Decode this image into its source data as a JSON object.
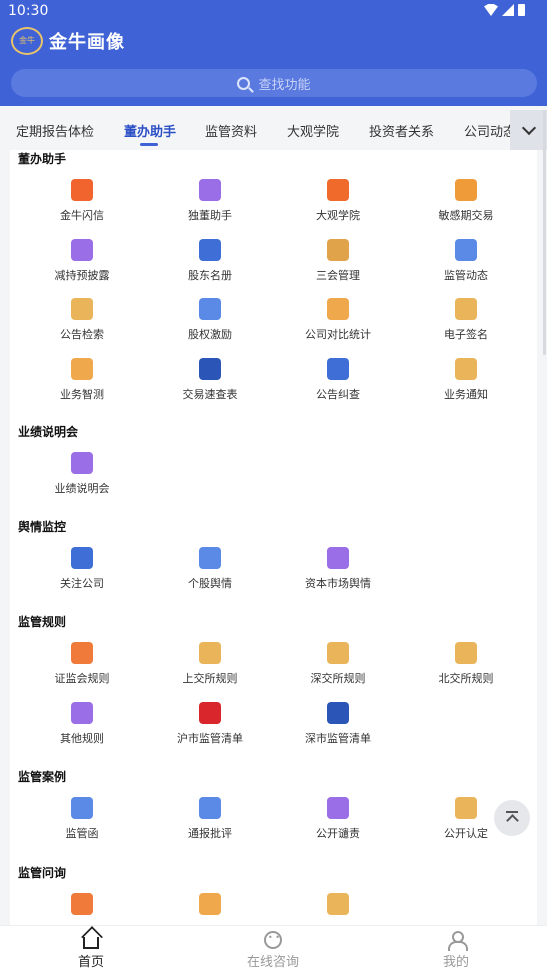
{
  "status_bar": {
    "time": "10:30"
  },
  "app": {
    "title": "金牛画像",
    "logo_text": "金牛"
  },
  "search": {
    "placeholder": "查找功能"
  },
  "tabs": [
    "定期报告体检",
    "董办助手",
    "监管资料",
    "大观学院",
    "投资者关系",
    "公司动态"
  ],
  "active_tab": "董办助手",
  "sections": [
    {
      "title": "董办助手",
      "items": [
        {
          "label": "金牛闪信",
          "icon": "lightning-icon",
          "color": "#f2642d"
        },
        {
          "label": "独董助手",
          "icon": "person-icon",
          "color": "#9a6ee6"
        },
        {
          "label": "大观学院",
          "icon": "graduation-cap-icon",
          "color": "#f06a2b"
        },
        {
          "label": "敏感期交易",
          "icon": "coin-hand-icon",
          "color": "#f09b3a"
        },
        {
          "label": "减持预披露",
          "icon": "document-list-icon",
          "color": "#9a6ee6"
        },
        {
          "label": "股东名册",
          "icon": "roster-icon",
          "color": "#3f6fd6"
        },
        {
          "label": "三会管理",
          "icon": "meeting-icon",
          "color": "#e0a34a"
        },
        {
          "label": "监管动态",
          "icon": "news-icon",
          "color": "#5b8ae6"
        },
        {
          "label": "公告检索",
          "icon": "briefcase-icon",
          "color": "#e9b45a"
        },
        {
          "label": "股权激励",
          "icon": "pie-chart-icon",
          "color": "#5b8ae6"
        },
        {
          "label": "公司对比统计",
          "icon": "compare-icon",
          "color": "#f0a84c"
        },
        {
          "label": "电子签名",
          "icon": "pen-icon",
          "color": "#e9b45a"
        },
        {
          "label": "业务智测",
          "icon": "checklist-icon",
          "color": "#f0a84c"
        },
        {
          "label": "交易速查表",
          "icon": "search-table-icon",
          "color": "#2c55b8"
        },
        {
          "label": "公告纠查",
          "icon": "house-search-icon",
          "color": "#3f6fd6"
        },
        {
          "label": "业务通知",
          "icon": "notice-icon",
          "color": "#e9b45a"
        }
      ]
    },
    {
      "title": "业绩说明会",
      "items": [
        {
          "label": "业绩说明会",
          "icon": "presentation-icon",
          "color": "#9a6ee6"
        }
      ]
    },
    {
      "title": "舆情监控",
      "items": [
        {
          "label": "关注公司",
          "icon": "building-icon",
          "color": "#3f6fd6"
        },
        {
          "label": "个股舆情",
          "icon": "stock-bars-icon",
          "color": "#5b8ae6"
        },
        {
          "label": "资本市场舆情",
          "icon": "market-chart-icon",
          "color": "#9a6ee6"
        }
      ]
    },
    {
      "title": "监管规则",
      "items": [
        {
          "label": "证监会规则",
          "icon": "rule-doc-icon",
          "color": "#f07a3a"
        },
        {
          "label": "上交所规则",
          "icon": "rule-doc-icon",
          "color": "#e9b45a"
        },
        {
          "label": "深交所规则",
          "icon": "rule-doc-icon",
          "color": "#e9b45a"
        },
        {
          "label": "北交所规则",
          "icon": "rule-doc-icon",
          "color": "#e9b45a"
        },
        {
          "label": "其他规则",
          "icon": "rule-doc-icon",
          "color": "#9a6ee6"
        },
        {
          "label": "沪市监管清单",
          "icon": "list-doc-icon",
          "color": "#d9262c"
        },
        {
          "label": "深市监管清单",
          "icon": "list-doc-icon",
          "color": "#2c55b8"
        }
      ]
    },
    {
      "title": "监管案例",
      "items": [
        {
          "label": "监管函",
          "icon": "envelope-icon",
          "color": "#5b8ae6"
        },
        {
          "label": "通报批评",
          "icon": "warning-icon",
          "color": "#5b8ae6"
        },
        {
          "label": "公开谴责",
          "icon": "alarm-icon",
          "color": "#9a6ee6"
        },
        {
          "label": "公开认定",
          "icon": "badge-alert-icon",
          "color": "#e9b45a"
        }
      ]
    },
    {
      "title": "监管问询",
      "items": [
        {
          "label": "",
          "icon": "question-chat-icon",
          "color": "#f07a3a"
        },
        {
          "label": "",
          "icon": "question-chat-icon",
          "color": "#f0a84c"
        },
        {
          "label": "",
          "icon": "question-icon",
          "color": "#e9b45a"
        }
      ]
    }
  ],
  "bottom_nav": [
    {
      "label": "首页",
      "icon": "home-icon"
    },
    {
      "label": "在线咨询",
      "icon": "chat-icon"
    },
    {
      "label": "我的",
      "icon": "profile-icon"
    }
  ]
}
